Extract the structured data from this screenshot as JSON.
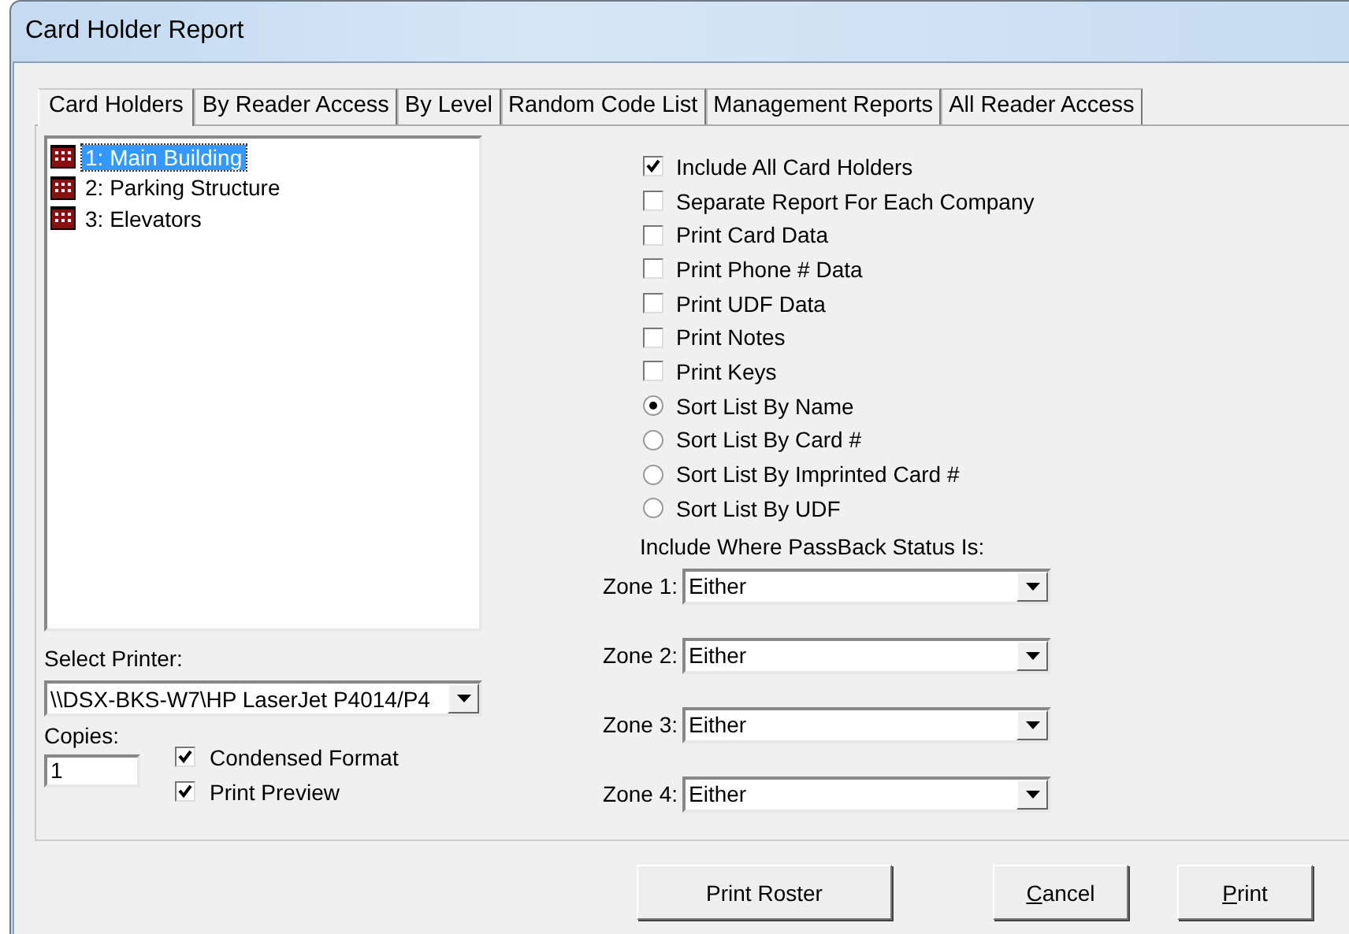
{
  "window": {
    "title": "Card Holder Report"
  },
  "tabs": [
    {
      "label": "Card Holders",
      "selected": true
    },
    {
      "label": "By Reader Access",
      "selected": false
    },
    {
      "label": "By Level",
      "selected": false
    },
    {
      "label": "Random Code List",
      "selected": false
    },
    {
      "label": "Management Reports",
      "selected": false
    },
    {
      "label": "All Reader Access",
      "selected": false
    }
  ],
  "locations": [
    {
      "label": "1:  Main Building",
      "selected": true
    },
    {
      "label": "2:  Parking Structure",
      "selected": false
    },
    {
      "label": "3:  Elevators",
      "selected": false
    }
  ],
  "options": [
    {
      "kind": "checkbox",
      "label": "Include All Card Holders",
      "checked": true
    },
    {
      "kind": "checkbox",
      "label": "Separate Report For Each Company",
      "checked": false
    },
    {
      "kind": "checkbox",
      "label": "Print Card Data",
      "checked": false
    },
    {
      "kind": "checkbox",
      "label": "Print Phone # Data",
      "checked": false
    },
    {
      "kind": "checkbox",
      "label": "Print UDF Data",
      "checked": false
    },
    {
      "kind": "checkbox",
      "label": "Print Notes",
      "checked": false
    },
    {
      "kind": "checkbox",
      "label": "Print Keys",
      "checked": false
    },
    {
      "kind": "radio",
      "label": "Sort List By Name",
      "checked": true
    },
    {
      "kind": "radio",
      "label": "Sort List By Card #",
      "checked": false
    },
    {
      "kind": "radio",
      "label": "Sort List By Imprinted Card #",
      "checked": false
    },
    {
      "kind": "radio",
      "label": "Sort List By UDF",
      "checked": false
    }
  ],
  "passback": {
    "heading": "Include Where PassBack Status Is:",
    "zones": [
      {
        "label": "Zone 1:",
        "value": "Either"
      },
      {
        "label": "Zone 2:",
        "value": "Either"
      },
      {
        "label": "Zone 3:",
        "value": "Either"
      },
      {
        "label": "Zone 4:",
        "value": "Either"
      }
    ]
  },
  "printer": {
    "label": "Select Printer:",
    "value": "\\\\DSX-BKS-W7\\HP LaserJet P4014/P4"
  },
  "copies": {
    "label": "Copies:",
    "value": "1"
  },
  "print_options": [
    {
      "label": "Condensed Format",
      "checked": true
    },
    {
      "label": "Print Preview",
      "checked": true
    }
  ],
  "buttons": [
    {
      "label": "Print Roster",
      "mnemonic": false
    },
    {
      "label": "Cancel",
      "mnemonic": true
    },
    {
      "label": "Print",
      "mnemonic": true
    }
  ]
}
